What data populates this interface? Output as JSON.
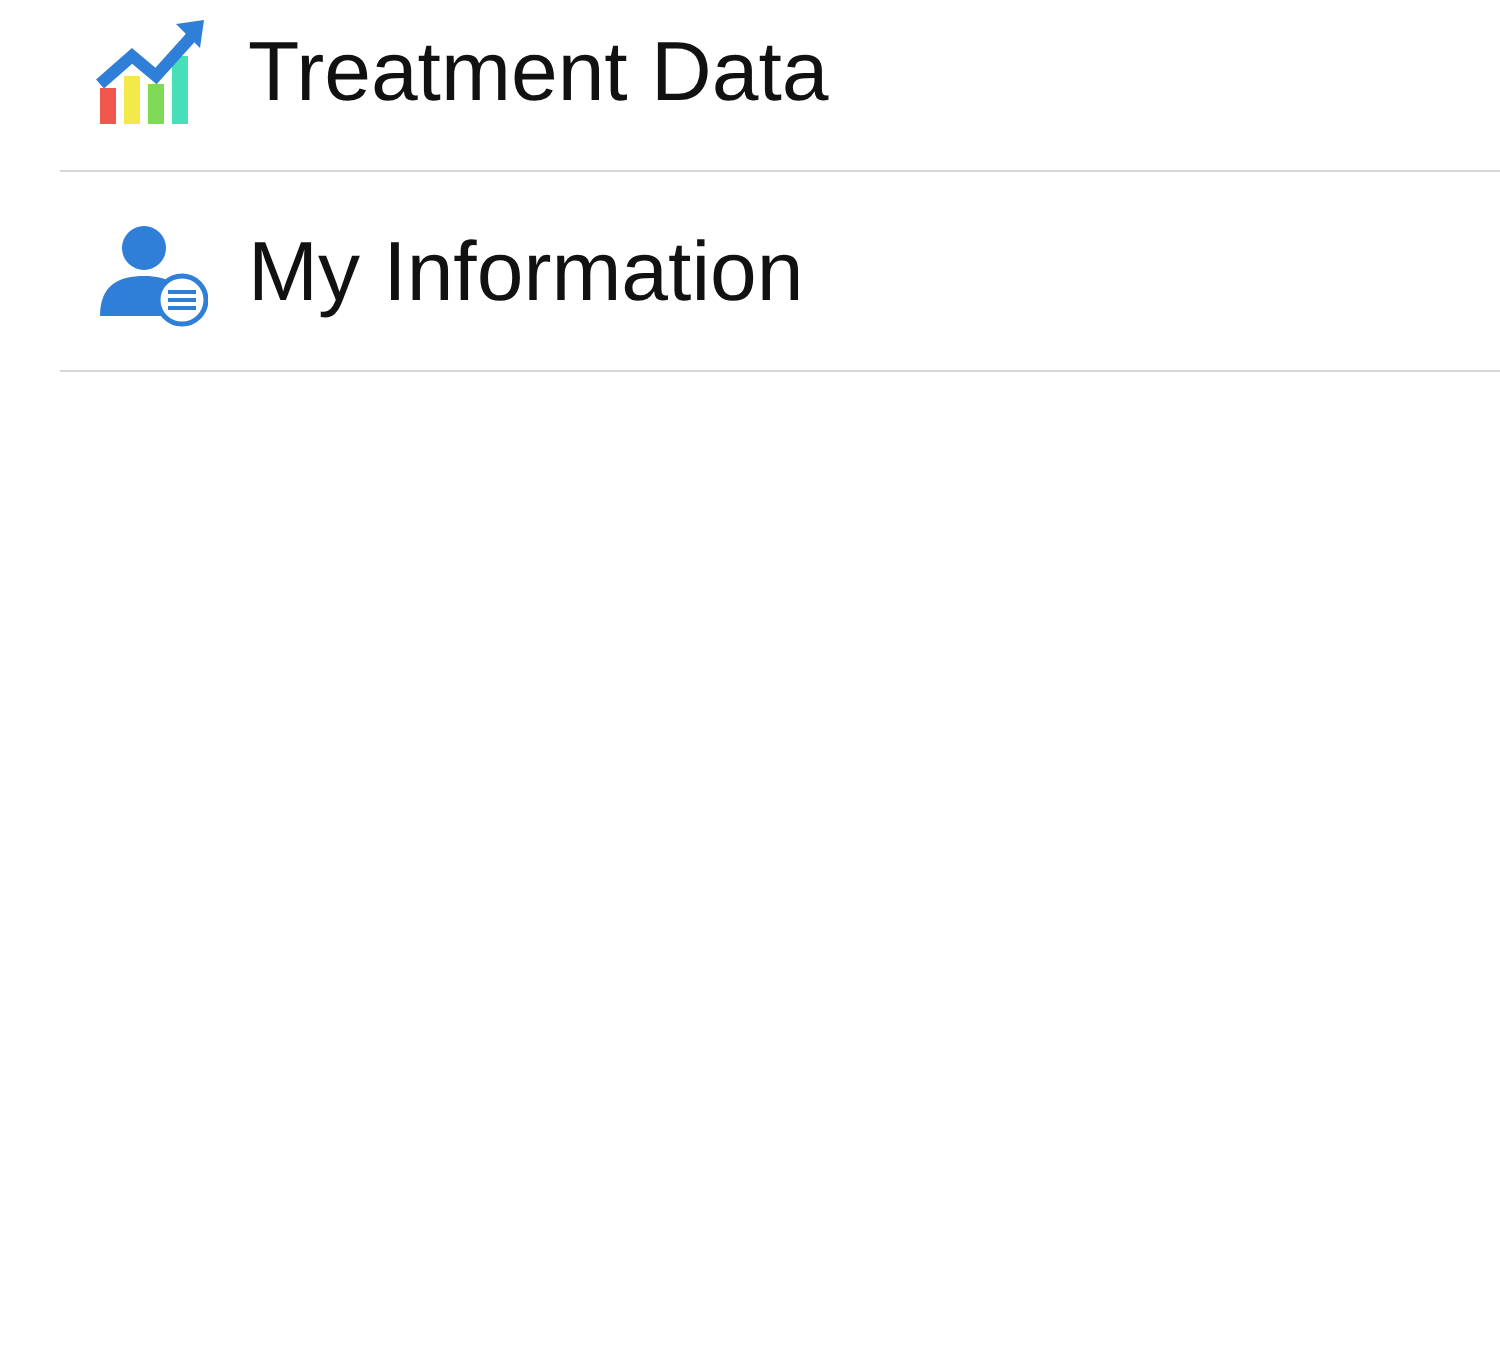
{
  "menu": {
    "items": [
      {
        "label": "Treatment Data"
      },
      {
        "label": "My Information"
      }
    ]
  }
}
